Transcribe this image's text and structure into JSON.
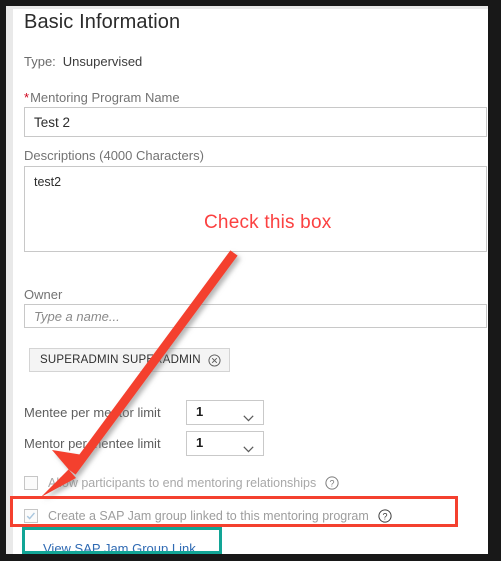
{
  "panel": {
    "title": "Basic Information"
  },
  "type_row": {
    "label": "Type:",
    "value": "Unsupervised"
  },
  "program_name": {
    "required_marker": "*",
    "label": "Mentoring Program Name",
    "value": "Test 2"
  },
  "description": {
    "label": "Descriptions (4000 Characters)",
    "value": "test2"
  },
  "owner": {
    "label": "Owner",
    "placeholder": "Type a name...",
    "token": {
      "name": "SUPERADMIN SUPERADMIN",
      "remove_icon": "circle-x-icon"
    }
  },
  "limits": [
    {
      "label": "Mentee per mentor limit",
      "value": "1"
    },
    {
      "label": "Mentor per mentee limit",
      "value": "1"
    }
  ],
  "checkboxes": [
    {
      "label": "Allow participants to end mentoring relationships",
      "checked": false,
      "help_icon": "question-circle-icon"
    },
    {
      "label": "Create a SAP Jam group linked to this mentoring program",
      "checked": true,
      "help_icon": "question-circle-icon"
    }
  ],
  "jam_link": {
    "label": "View SAP Jam Group Link"
  },
  "annotations": {
    "callout_text": "Check this box",
    "arrow": "red-arrow-pointing-down-left",
    "highlight_red": "create-sap-jam-group-row",
    "highlight_teal": "view-sap-jam-group-link"
  },
  "colors": {
    "annotation_red": "#fb4141",
    "highlight_red": "#f4402f",
    "highlight_teal": "#12a596",
    "link_blue": "#2f6ab3",
    "required_red": "#d0021b"
  }
}
